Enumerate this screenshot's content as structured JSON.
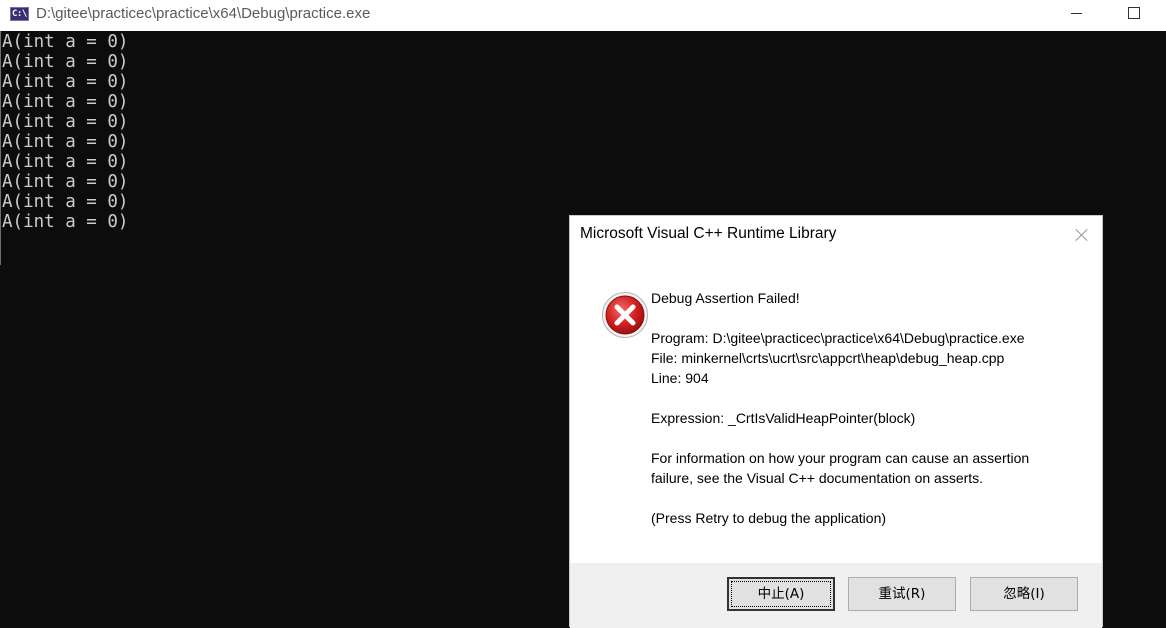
{
  "window": {
    "icon_text": "C:\\",
    "title": "D:\\gitee\\practicec\\practice\\x64\\Debug\\practice.exe"
  },
  "console": {
    "lines": [
      "A(int a = 0)",
      "A(int a = 0)",
      "A(int a = 0)",
      "A(int a = 0)",
      "A(int a = 0)",
      "A(int a = 0)",
      "A(int a = 0)",
      "A(int a = 0)",
      "A(int a = 0)",
      "A(int a = 0)"
    ]
  },
  "dialog": {
    "title": "Microsoft Visual C++ Runtime Library",
    "heading": "Debug Assertion Failed!",
    "program": "Program: D:\\gitee\\practicec\\practice\\x64\\Debug\\practice.exe",
    "file": "File: minkernel\\crts\\ucrt\\src\\appcrt\\heap\\debug_heap.cpp",
    "line": "Line: 904",
    "expression": "Expression: _CrtIsValidHeapPointer(block)",
    "info_1": "For information on how your program can cause an assertion",
    "info_2": "failure, see the Visual C++ documentation on asserts.",
    "press_retry": "(Press Retry to debug the application)",
    "buttons": {
      "abort": "中止(A)",
      "retry": "重试(R)",
      "ignore": "忽略(I)"
    }
  },
  "colors": {
    "console_bg": "#0c0c0c",
    "console_text": "#cccccc",
    "error_red": "#d42020"
  },
  "icons": {
    "app": "console-app-icon",
    "error": "error-icon",
    "close": "close-icon"
  }
}
